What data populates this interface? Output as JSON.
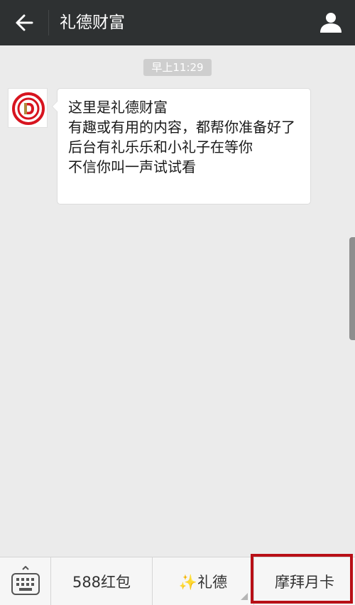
{
  "header": {
    "title": "礼德财富"
  },
  "chat": {
    "timestamp": "早上11:29",
    "message": "这里是礼德财富\n有趣或有用的内容，都帮你准备好了\n后台有礼乐乐和小礼子在等你\n不信你叫一声试试看"
  },
  "bottom_menu": {
    "items": [
      {
        "label": "588红包"
      },
      {
        "label": "✨礼德"
      },
      {
        "label": "摩拜月卡"
      }
    ]
  },
  "colors": {
    "header_bg": "#2e3132",
    "chat_bg": "#ebebeb",
    "highlight": "#b80f16",
    "logo_red": "#d7141f"
  },
  "icons": {
    "back": "back-arrow-icon",
    "profile": "person-icon",
    "keyboard": "keyboard-icon"
  }
}
